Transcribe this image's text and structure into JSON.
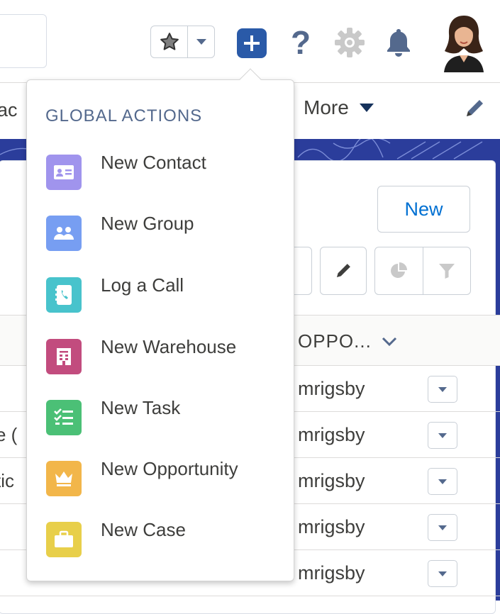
{
  "header": {
    "search_placeholder": "",
    "favorites": {
      "star_icon": "star-icon",
      "caret_icon": "caret-down-icon"
    },
    "global_actions_button": {
      "icon": "plus-icon",
      "color": "#2a5aa8"
    },
    "help_label": "?",
    "setup_icon": "gear-icon",
    "notifications_icon": "bell-icon",
    "avatar_icon": "user-avatar"
  },
  "nav": {
    "peek_text": "ac",
    "more_label": "More",
    "edit_icon": "pencil-icon"
  },
  "list": {
    "new_button": "New",
    "column_header": "OPPO...",
    "rows": [
      {
        "peek": "",
        "owner": "mrigsby"
      },
      {
        "peek": "e (",
        "owner": "mrigsby"
      },
      {
        "peek": "tic",
        "owner": "mrigsby"
      },
      {
        "peek": "",
        "owner": "mrigsby"
      },
      {
        "peek": "",
        "owner": "mrigsby"
      }
    ]
  },
  "global_actions": {
    "title": "GLOBAL ACTIONS",
    "items": [
      {
        "label": "New Contact",
        "icon": "contact-card-icon",
        "color": "#a094ed"
      },
      {
        "label": "New Group",
        "icon": "group-icon",
        "color": "#779ef2"
      },
      {
        "label": "Log a Call",
        "icon": "log-call-icon",
        "color": "#48c3cc"
      },
      {
        "label": "New Warehouse",
        "icon": "warehouse-icon",
        "color": "#c24c7e"
      },
      {
        "label": "New Task",
        "icon": "task-icon",
        "color": "#4bc076"
      },
      {
        "label": "New Opportunity",
        "icon": "opportunity-crown-icon",
        "color": "#f2b64a"
      },
      {
        "label": "New Case",
        "icon": "case-briefcase-icon",
        "color": "#e8cf4a"
      }
    ]
  }
}
